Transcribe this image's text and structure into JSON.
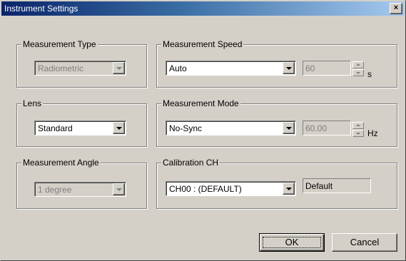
{
  "window": {
    "title": "Instrument Settings",
    "close_label": "×"
  },
  "groups": {
    "measurement_type": {
      "label": "Measurement Type",
      "value": "Radiometric",
      "enabled": false
    },
    "lens": {
      "label": "Lens",
      "value": "Standard",
      "enabled": true
    },
    "measurement_angle": {
      "label": "Measurement Angle",
      "value": "1 degree",
      "enabled": false
    },
    "measurement_speed": {
      "label": "Measurement Speed",
      "value": "Auto",
      "time_value": "60",
      "unit": "s"
    },
    "measurement_mode": {
      "label": "Measurement Mode",
      "value": "No-Sync",
      "freq_value": "60.00",
      "unit": "Hz"
    },
    "calibration_ch": {
      "label": "Calibration CH",
      "value": "CH00 : (DEFAULT)",
      "name": "Default"
    }
  },
  "buttons": {
    "ok": "OK",
    "cancel": "Cancel"
  }
}
